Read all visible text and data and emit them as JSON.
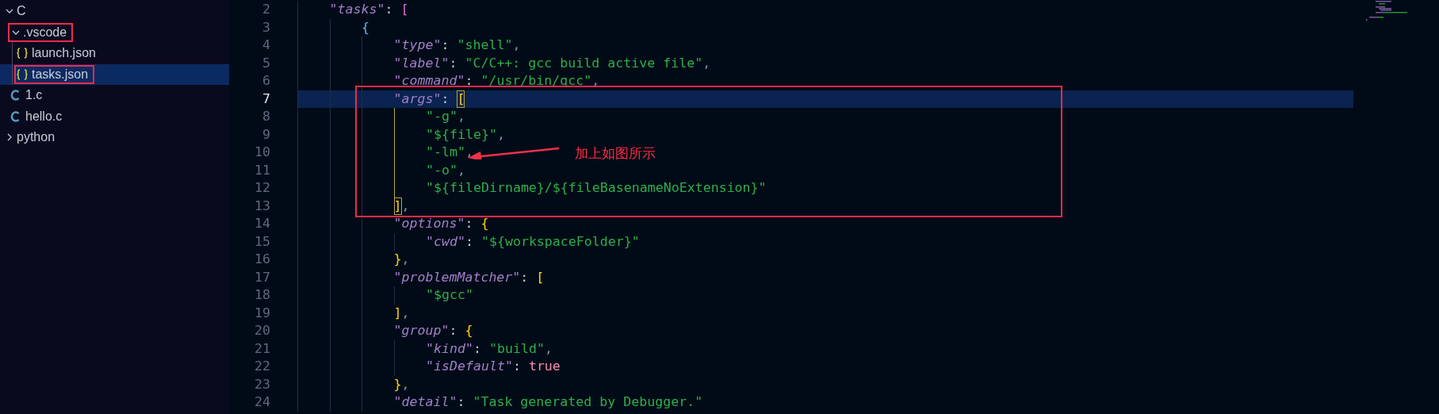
{
  "explorer": {
    "items": [
      {
        "name": "C",
        "kind": "folder",
        "expanded": true,
        "selected": false,
        "boxed": false,
        "children": [
          {
            "name": ".vscode",
            "kind": "folder",
            "expanded": true,
            "selected": false,
            "boxed": true,
            "children": [
              {
                "name": "launch.json",
                "kind": "json",
                "selected": false,
                "boxed": false
              },
              {
                "name": "tasks.json",
                "kind": "json",
                "selected": true,
                "boxed": true
              }
            ]
          },
          {
            "name": "1.c",
            "kind": "c",
            "selected": false,
            "boxed": false
          },
          {
            "name": "hello.c",
            "kind": "c",
            "selected": false,
            "boxed": false
          }
        ]
      },
      {
        "name": "python",
        "kind": "folder",
        "expanded": false,
        "selected": false,
        "boxed": false
      }
    ]
  },
  "editor": {
    "lines": [
      {
        "number": "2",
        "current": false,
        "bracket_guide": false,
        "tokens": [
          {
            "kind": "key",
            "text": "\"tasks\""
          },
          {
            "kind": "punct",
            "text": ": "
          },
          {
            "kind": "bracket",
            "color": "#da70d6",
            "text": "["
          }
        ],
        "children": [
          {
            "number": "3",
            "current": false,
            "bracket_guide": false,
            "tokens": [
              {
                "kind": "bracket",
                "color": "#5fb3f5",
                "text": "{"
              }
            ],
            "children": [
              {
                "number": "4",
                "current": false,
                "tokens": [
                  {
                    "kind": "key",
                    "text": "\"type\""
                  },
                  {
                    "kind": "punct",
                    "text": ": "
                  },
                  {
                    "kind": "string",
                    "text": "\"shell\""
                  },
                  {
                    "kind": "comma",
                    "text": ","
                  }
                ]
              },
              {
                "number": "5",
                "current": false,
                "tokens": [
                  {
                    "kind": "key",
                    "text": "\"label\""
                  },
                  {
                    "kind": "punct",
                    "text": ": "
                  },
                  {
                    "kind": "string",
                    "text": "\"C/C++: gcc build active file\""
                  },
                  {
                    "kind": "comma",
                    "text": ","
                  }
                ]
              },
              {
                "number": "6",
                "current": false,
                "tokens": [
                  {
                    "kind": "key",
                    "text": "\"command\""
                  },
                  {
                    "kind": "punct",
                    "text": ": "
                  },
                  {
                    "kind": "string",
                    "text": "\"/usr/bin/gcc\""
                  },
                  {
                    "kind": "comma",
                    "text": ","
                  }
                ]
              },
              {
                "number": "7",
                "current": true,
                "bracket_guide": true,
                "tokens": [
                  {
                    "kind": "key",
                    "text": "\"args\""
                  },
                  {
                    "kind": "punct",
                    "text": ": "
                  },
                  {
                    "kind": "bracket",
                    "color": "#ffd700",
                    "matched": true,
                    "text": "["
                  }
                ],
                "children": [
                  {
                    "number": "8",
                    "current": false,
                    "tokens": [
                      {
                        "kind": "string",
                        "text": "\"-g\""
                      },
                      {
                        "kind": "comma",
                        "text": ","
                      }
                    ]
                  },
                  {
                    "number": "9",
                    "current": false,
                    "tokens": [
                      {
                        "kind": "string",
                        "text": "\"${file}\""
                      },
                      {
                        "kind": "comma",
                        "text": ","
                      }
                    ]
                  },
                  {
                    "number": "10",
                    "current": false,
                    "tokens": [
                      {
                        "kind": "string",
                        "text": "\"-lm\""
                      },
                      {
                        "kind": "comma",
                        "text": ","
                      }
                    ]
                  },
                  {
                    "number": "11",
                    "current": false,
                    "tokens": [
                      {
                        "kind": "string",
                        "text": "\"-o\""
                      },
                      {
                        "kind": "comma",
                        "text": ","
                      }
                    ]
                  },
                  {
                    "number": "12",
                    "current": false,
                    "tokens": [
                      {
                        "kind": "string",
                        "text": "\"${fileDirname}/${fileBasenameNoExtension}\""
                      }
                    ]
                  }
                ]
              },
              {
                "number": "13",
                "current": false,
                "tokens": [
                  {
                    "kind": "bracket",
                    "color": "#ffd700",
                    "matched": true,
                    "text": "]"
                  },
                  {
                    "kind": "comma",
                    "text": ","
                  }
                ]
              },
              {
                "number": "14",
                "current": false,
                "bracket_guide": false,
                "tokens": [
                  {
                    "kind": "key",
                    "text": "\"options\""
                  },
                  {
                    "kind": "punct",
                    "text": ": "
                  },
                  {
                    "kind": "bracket",
                    "color": "#ffd700",
                    "text": "{"
                  }
                ],
                "children": [
                  {
                    "number": "15",
                    "current": false,
                    "tokens": [
                      {
                        "kind": "key",
                        "text": "\"cwd\""
                      },
                      {
                        "kind": "punct",
                        "text": ": "
                      },
                      {
                        "kind": "string",
                        "text": "\"${workspaceFolder}\""
                      }
                    ]
                  }
                ]
              },
              {
                "number": "16",
                "current": false,
                "tokens": [
                  {
                    "kind": "bracket",
                    "color": "#ffd700",
                    "text": "}"
                  },
                  {
                    "kind": "comma",
                    "text": ","
                  }
                ]
              },
              {
                "number": "17",
                "current": false,
                "bracket_guide": false,
                "tokens": [
                  {
                    "kind": "key",
                    "text": "\"problemMatcher\""
                  },
                  {
                    "kind": "punct",
                    "text": ": "
                  },
                  {
                    "kind": "bracket",
                    "color": "#ffd700",
                    "text": "["
                  }
                ],
                "children": [
                  {
                    "number": "18",
                    "current": false,
                    "tokens": [
                      {
                        "kind": "string",
                        "text": "\"$gcc\""
                      }
                    ]
                  }
                ]
              },
              {
                "number": "19",
                "current": false,
                "tokens": [
                  {
                    "kind": "bracket",
                    "color": "#ffd700",
                    "text": "]"
                  },
                  {
                    "kind": "comma",
                    "text": ","
                  }
                ]
              },
              {
                "number": "20",
                "current": false,
                "bracket_guide": false,
                "tokens": [
                  {
                    "kind": "key",
                    "text": "\"group\""
                  },
                  {
                    "kind": "punct",
                    "text": ": "
                  },
                  {
                    "kind": "bracket",
                    "color": "#ffd700",
                    "text": "{"
                  }
                ],
                "children": [
                  {
                    "number": "21",
                    "current": false,
                    "tokens": [
                      {
                        "kind": "key",
                        "text": "\"kind\""
                      },
                      {
                        "kind": "punct",
                        "text": ": "
                      },
                      {
                        "kind": "string",
                        "text": "\"build\""
                      },
                      {
                        "kind": "comma",
                        "text": ","
                      }
                    ]
                  },
                  {
                    "number": "22",
                    "current": false,
                    "tokens": [
                      {
                        "kind": "key",
                        "text": "\"isDefault\""
                      },
                      {
                        "kind": "punct",
                        "text": ": "
                      },
                      {
                        "kind": "boolean",
                        "text": "true"
                      }
                    ]
                  }
                ]
              },
              {
                "number": "23",
                "current": false,
                "tokens": [
                  {
                    "kind": "bracket",
                    "color": "#ffd700",
                    "text": "}"
                  },
                  {
                    "kind": "comma",
                    "text": ","
                  }
                ]
              },
              {
                "number": "24",
                "current": false,
                "tokens": [
                  {
                    "kind": "key",
                    "text": "\"detail\""
                  },
                  {
                    "kind": "punct",
                    "text": ": "
                  },
                  {
                    "kind": "string",
                    "text": "\"Task generated by Debugger.\""
                  }
                ]
              }
            ]
          }
        ]
      }
    ]
  },
  "annotation": {
    "text": "加上如图所示"
  }
}
